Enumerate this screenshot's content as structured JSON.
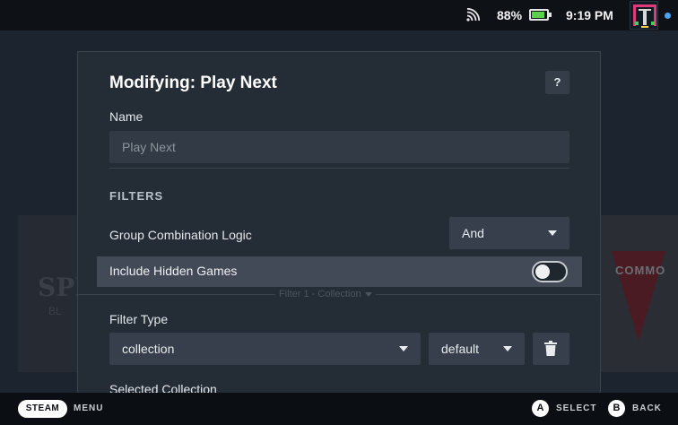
{
  "status_bar": {
    "battery_percent": "88%",
    "battery_level": 0.88,
    "time": "9:19 PM",
    "icons": [
      "wifi-icon",
      "battery-icon",
      "avatar",
      "online-dot"
    ]
  },
  "background": {
    "left_tile_glyph": "SPI",
    "left_tile_glyph2": "BL",
    "right_tile_word": "COMMO"
  },
  "modal": {
    "title": "Modifying: Play Next",
    "help_label": "?",
    "name_label": "Name",
    "name_placeholder": "Play Next",
    "filters_heading": "FILTERS",
    "group_logic_label": "Group Combination Logic",
    "group_logic_value": "And",
    "include_hidden_label": "Include Hidden Games",
    "include_hidden_enabled": false,
    "filter_section_label": "Filter 1 - Collection",
    "filter_type_label": "Filter Type",
    "filter_type_value": "collection",
    "filter_mode_value": "default",
    "selected_collection_label": "Selected Collection"
  },
  "footer": {
    "steam_label": "STEAM",
    "menu_label": "MENU",
    "a_label": "A",
    "select_label": "SELECT",
    "b_label": "B",
    "back_label": "BACK"
  },
  "colors": {
    "accent_battery": "#5bd04b",
    "online_dot": "#4aa3f0",
    "modal_bg": "#242c36",
    "highlight_row": "#414a56"
  }
}
